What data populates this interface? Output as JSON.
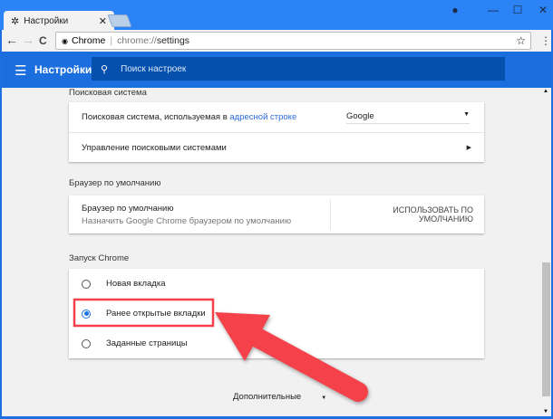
{
  "tab": {
    "title": "Настройки",
    "close": "✕"
  },
  "window": {
    "profile": "●",
    "minimize": "—",
    "maximize": "☐",
    "close": "✕"
  },
  "toolbar": {
    "back": "←",
    "forward": "→",
    "reload": "C",
    "site": "Chrome",
    "url_scheme": "chrome://",
    "url_path": "settings",
    "star": "☆",
    "menu": "⋮"
  },
  "header": {
    "title": "Настройки",
    "search_placeholder": "Поиск настроек"
  },
  "search_engine": {
    "heading": "Поисковая система",
    "row1_text": "Поисковая система, используемая в ",
    "row1_link": "адресной строке",
    "selected": "Google",
    "row2": "Управление поисковыми системами"
  },
  "default_browser": {
    "heading": "Браузер по умолчанию",
    "title": "Браузер по умолчанию",
    "subtitle": "Назначить Google Chrome браузером по умолчанию",
    "button": "ИСПОЛЬЗОВАТЬ ПО УМОЛЧАНИЮ"
  },
  "startup": {
    "heading": "Запуск Chrome",
    "options": [
      {
        "label": "Новая вкладка",
        "checked": false
      },
      {
        "label": "Ранее открытые вкладки",
        "checked": true
      },
      {
        "label": "Заданные страницы",
        "checked": false
      }
    ]
  },
  "advanced": {
    "label": "Дополнительные"
  },
  "annotation": {
    "color": "#f5424a"
  }
}
